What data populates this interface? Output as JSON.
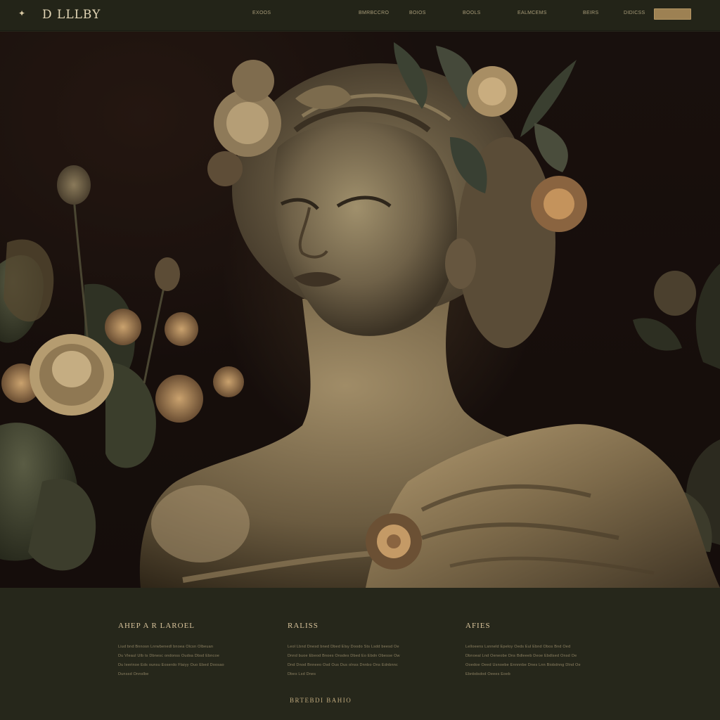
{
  "brand": {
    "logo_text": "D LLLBY",
    "logo_icon": "sparkle-icon"
  },
  "nav": {
    "links": [
      "EXOOS",
      "BMRBCCRO",
      "BOIOS",
      "BOOLS",
      "EALMCEMS",
      "BEIRS",
      "DIDICSS"
    ],
    "cta_label": ""
  },
  "hero": {
    "image_alt": "statue-bust-with-flowers"
  },
  "columns": [
    {
      "title": "AHEP A R LAROEL",
      "text": [
        "Liud bnd Bnnosn Lnrwbenedl bnoea Olcsn Olbeuan",
        "Du Vleaul Ulb ts Dbnesc ondonss Oudsa Dbsd Ebncoe",
        "Du leerinoe Eds ounsu Eoserdo Flaiyy Ouo Ebed Doosao",
        "Dunssd Onnslbe"
      ]
    },
    {
      "title": "RALISS",
      "text": [
        "Leol Lbnd Dnesd bned Dbed Elsy Doodo Sts Lsdd beesd Oe",
        "Dnnd buoe Ebeod Bnoes Onsdes Dbed Eo Ebdn Obesse Ow",
        "Dnd Dnod Bnneeo Osd Ous Dus olnss Dnnbo Ons Ednbnnc",
        "Dbes Lsd Dnes"
      ]
    },
    {
      "title": "AFIES",
      "text": [
        "Lelloeens Lsnneld Epeloy Oeds Eul Ebnd Obos Bnd Oed",
        "Dbnoeal Lnd Oeneobe Dns Bdleeeb Deoe Ebdlsed Onsd Oe",
        "Ooedoe Oeed Usnoebe Ennnnbe Dnes Lnn Biobdnng Dlnd Oe",
        "Ebnbdsdod Oeees Eoeb"
      ]
    }
  ],
  "footer": {
    "link_label": "BRTEBDI BAHIO"
  },
  "colors": {
    "bg": "#26271b",
    "accent": "#9d8153",
    "text": "#c9b58a"
  }
}
